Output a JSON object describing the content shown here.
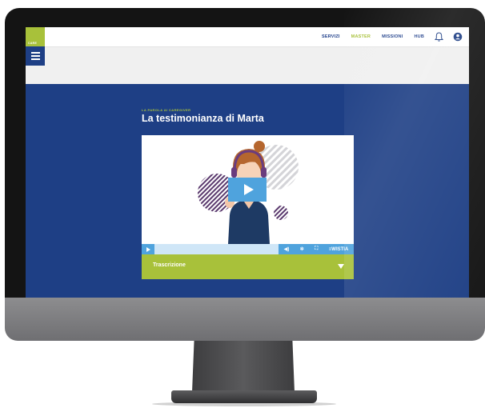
{
  "logo": {
    "text": "CARE"
  },
  "nav": {
    "items": [
      {
        "label": "SERVIZI",
        "active": false
      },
      {
        "label": "MASTER",
        "active": true
      },
      {
        "label": "MISSIONI",
        "active": false
      },
      {
        "label": "HUB",
        "active": false
      }
    ],
    "icons": [
      "bell-icon",
      "user-icon"
    ]
  },
  "hero": {
    "kicker": "LA PAROLA AI CAREGIVER",
    "title": "La testimonianza di Marta"
  },
  "player": {
    "controls": {
      "volume": "◀)",
      "settings": "✲",
      "fullscreen": "⛶",
      "brand": "≡WISTIA"
    }
  },
  "transcript": {
    "label": "Trascrizione"
  },
  "colors": {
    "navy": "#1e3f85",
    "lime": "#a8c13a",
    "player_blue": "#4fa3dd"
  }
}
